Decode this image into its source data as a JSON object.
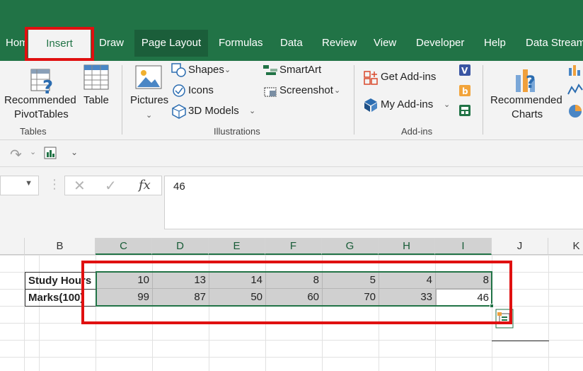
{
  "tabs": [
    {
      "label": "Home"
    },
    {
      "label": "Insert"
    },
    {
      "label": "Draw"
    },
    {
      "label": "Page Layout"
    },
    {
      "label": "Formulas"
    },
    {
      "label": "Data"
    },
    {
      "label": "Review"
    },
    {
      "label": "View"
    },
    {
      "label": "Developer"
    },
    {
      "label": "Help"
    },
    {
      "label": "Data Stream"
    }
  ],
  "ribbon": {
    "tables": {
      "group_label": "Tables",
      "recommended_pivot_line1": "Recommended",
      "recommended_pivot_line2": "PivotTables",
      "table_label": "Table"
    },
    "illustrations": {
      "group_label": "Illustrations",
      "pictures_label": "Pictures",
      "shapes_label": "Shapes",
      "icons_label": "Icons",
      "models_label": "3D Models",
      "smartart_label": "SmartArt",
      "screenshot_label": "Screenshot"
    },
    "addins": {
      "group_label": "Add-ins",
      "get_addins_label": "Get Add-ins",
      "my_addins_label": "My Add-ins"
    },
    "charts": {
      "recommended_line1": "Recommended",
      "recommended_line2": "Charts"
    }
  },
  "formula_bar": {
    "fx_label": "fx",
    "value": "46"
  },
  "grid": {
    "columns": [
      "B",
      "C",
      "D",
      "E",
      "F",
      "G",
      "H",
      "I",
      "J",
      "K"
    ],
    "rows": [
      {
        "label": "Study Hours",
        "values": [
          "10",
          "13",
          "14",
          "8",
          "5",
          "4",
          "8"
        ]
      },
      {
        "label": "Marks(100)",
        "values": [
          "99",
          "87",
          "50",
          "60",
          "70",
          "33",
          "46"
        ]
      }
    ]
  },
  "colors": {
    "accent": "#217346",
    "highlight": "#e01010"
  }
}
